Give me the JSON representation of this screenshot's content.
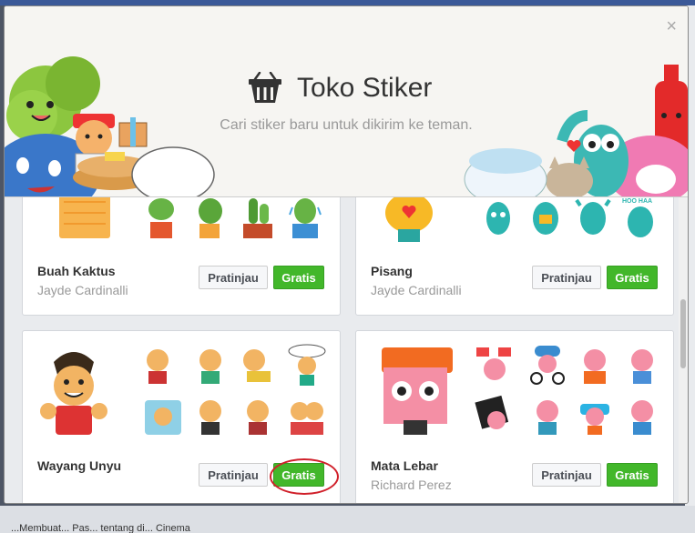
{
  "store": {
    "title": "Toko Stiker",
    "subtitle": "Cari stiker baru untuk dikirim ke teman.",
    "close_glyph": "×"
  },
  "packs": [
    {
      "name": "Buah Kaktus",
      "author": "Jayde Cardinalli",
      "preview_label": "Pratinjau",
      "free_label": "Gratis"
    },
    {
      "name": "Pisang",
      "author": "Jayde Cardinalli",
      "preview_label": "Pratinjau",
      "free_label": "Gratis"
    },
    {
      "name": "Wayang Unyu",
      "author": "",
      "preview_label": "Pratinjau",
      "free_label": "Gratis"
    },
    {
      "name": "Mata Lebar",
      "author": "Richard Perez",
      "preview_label": "Pratinjau",
      "free_label": "Gratis"
    }
  ],
  "background": {
    "bottom_snippet": "...Membuat... Pas... tentang di... Cinema"
  },
  "colors": {
    "accent_green": "#42b72a",
    "annotation_red": "#d0202a",
    "facebook_blue": "#3b5998"
  }
}
